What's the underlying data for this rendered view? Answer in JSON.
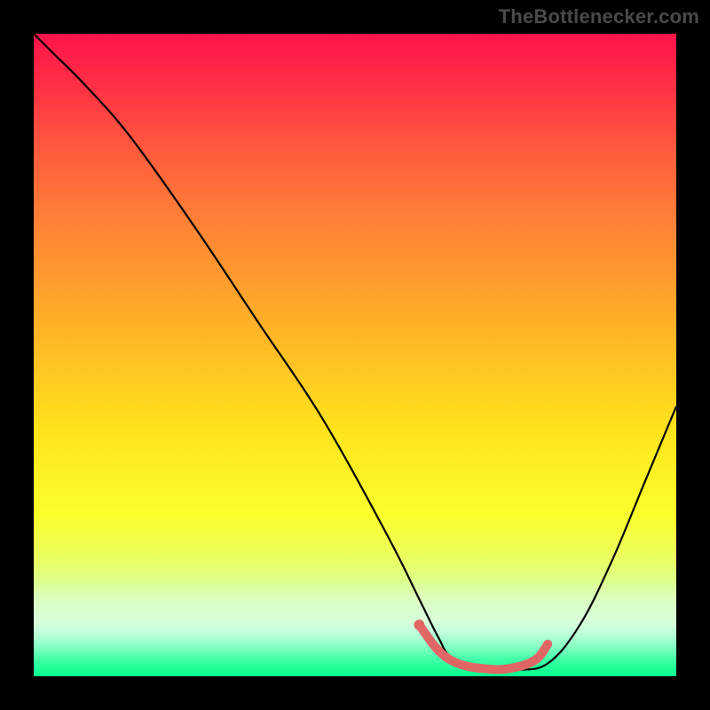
{
  "watermark": "TheBottlenecker.com",
  "colors": {
    "bg": "#000000",
    "curve": "#000000",
    "marker": "#e06666"
  },
  "chart_data": {
    "type": "line",
    "title": "",
    "xlabel": "",
    "ylabel": "",
    "xlim": [
      0,
      100
    ],
    "ylim": [
      0,
      100
    ],
    "grid": false,
    "series": [
      {
        "name": "bottleneck-curve",
        "x": [
          0,
          3,
          8,
          15,
          25,
          35,
          45,
          55,
          60,
          63,
          65,
          70,
          75,
          80,
          85,
          90,
          95,
          100
        ],
        "y": [
          100,
          97,
          92,
          84,
          70,
          55,
          40,
          22,
          12,
          6,
          3,
          1,
          1,
          2,
          8,
          18,
          30,
          42
        ]
      }
    ],
    "markers": {
      "name": "highlight-region",
      "x": [
        60,
        63,
        66,
        70,
        74,
        78,
        80
      ],
      "y": [
        8,
        4,
        2,
        1.2,
        1.2,
        2.5,
        5
      ]
    }
  }
}
